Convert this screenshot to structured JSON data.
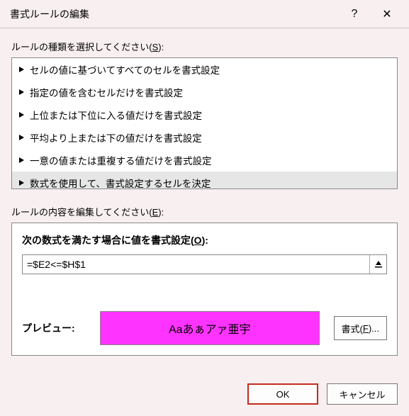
{
  "titlebar": {
    "title": "書式ルールの編集",
    "help": "?",
    "close": "✕"
  },
  "ruleType": {
    "label_pre": "ルールの種類を選択してください(",
    "label_key": "S",
    "label_post": "):",
    "items": [
      "セルの値に基づいてすべてのセルを書式設定",
      "指定の値を含むセルだけを書式設定",
      "上位または下位に入る値だけを書式設定",
      "平均より上または下の値だけを書式設定",
      "一意の値または重複する値だけを書式設定",
      "数式を使用して、書式設定するセルを決定"
    ],
    "selected_index": 5
  },
  "ruleEdit": {
    "label_pre": "ルールの内容を編集してください(",
    "label_key": "E",
    "label_post": "):",
    "formula_label_pre": "次の数式を満たす場合に値を書式設定(",
    "formula_label_key": "O",
    "formula_label_post": "):",
    "formula_value": "=$E2<=$H$1",
    "preview_label": "プレビュー:",
    "preview_text": "Aaあぁアァ亜宇",
    "preview_bg": "#ff33ff",
    "format_btn_pre": "書式(",
    "format_btn_key": "F",
    "format_btn_post": ")..."
  },
  "footer": {
    "ok": "OK",
    "cancel": "キャンセル"
  }
}
